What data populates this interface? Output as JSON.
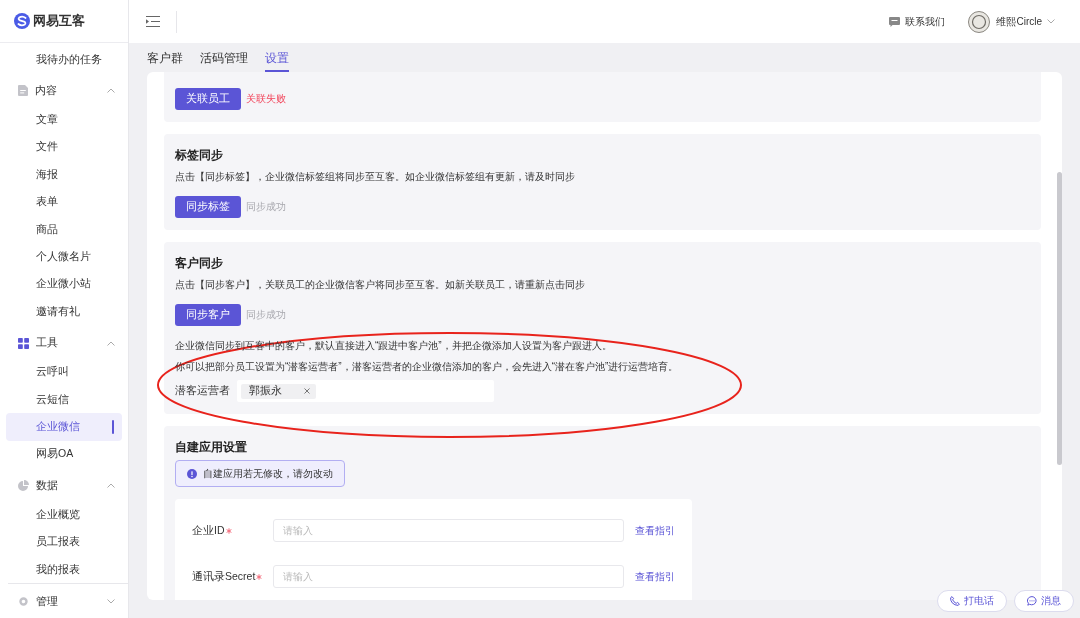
{
  "logo": {
    "text": "网易互客"
  },
  "header": {
    "contact": "联系我们",
    "user": "维熙Circle"
  },
  "sidebar": {
    "items": [
      {
        "kind": "link",
        "label": "我待办的任务",
        "selected": false
      },
      {
        "kind": "group",
        "label": "内容",
        "expanded": true,
        "active": false,
        "separated": false,
        "children": [
          {
            "label": "文章",
            "selected": false
          },
          {
            "label": "文件",
            "selected": false
          },
          {
            "label": "海报",
            "selected": false
          },
          {
            "label": "表单",
            "selected": false
          },
          {
            "label": "商品",
            "selected": false
          },
          {
            "label": "个人微名片",
            "selected": false
          },
          {
            "label": "企业微小站",
            "selected": false
          },
          {
            "label": "邀请有礼",
            "selected": false
          }
        ]
      },
      {
        "kind": "group",
        "label": "工具",
        "expanded": true,
        "active": true,
        "separated": false,
        "children": [
          {
            "label": "云呼叫",
            "selected": false
          },
          {
            "label": "云短信",
            "selected": false
          },
          {
            "label": "企业微信",
            "selected": true
          },
          {
            "label": "网易OA",
            "selected": false
          }
        ]
      },
      {
        "kind": "group",
        "label": "数据",
        "expanded": true,
        "active": false,
        "separated": false,
        "children": [
          {
            "label": "企业概览",
            "selected": false
          },
          {
            "label": "员工报表",
            "selected": false
          },
          {
            "label": "我的报表",
            "selected": false
          }
        ]
      },
      {
        "kind": "group",
        "label": "管理",
        "expanded": false,
        "active": false,
        "separated": true
      }
    ]
  },
  "tabs": [
    {
      "label": "客户群",
      "selected": false
    },
    {
      "label": "活码管理",
      "selected": false
    },
    {
      "label": "设置",
      "selected": true
    }
  ],
  "sections": [
    {
      "kind": "sync",
      "button": "关联员工",
      "status": {
        "text": "关联失败",
        "kind": "error"
      }
    },
    {
      "kind": "sync",
      "title": "标签同步",
      "description": "点击【同步标签】，企业微信标签组将同步至互客。如企业微信标签组有更新，请及时同步",
      "button": "同步标签",
      "status": {
        "text": "同步成功",
        "kind": "success"
      }
    },
    {
      "kind": "sync",
      "title": "客户同步",
      "description": "点击【同步客户】，关联员工的企业微信客户将同步至互客。如新关联员工，请重新点击同步",
      "button": "同步客户",
      "status": {
        "text": "同步成功",
        "kind": "success"
      },
      "notes": [
        "企业微信同步到互客中的客户，默认直接进入“跟进中客户池”，并把企微添加人设置为客户跟进人。",
        "你可以把部分员工设置为“潜客运营者”，潜客运营者的企业微信添加的客户，会先进入“潜在客户池”进行运营培育。"
      ],
      "operator_field": {
        "label": "潜客运营者",
        "tags": [
          "郭振永"
        ]
      }
    },
    {
      "kind": "app_settings",
      "title": "自建应用设置",
      "alert": "自建应用若无修改，请勿改动",
      "fields": [
        {
          "label": "企业ID",
          "required": true,
          "placeholder": "请输入",
          "link": "查看指引"
        },
        {
          "label": "通讯录Secret",
          "required": true,
          "placeholder": "请输入",
          "link": "查看指引"
        }
      ]
    }
  ],
  "floating_buttons": [
    {
      "kind": "call",
      "label": "打电话"
    },
    {
      "kind": "message",
      "label": "消息"
    }
  ]
}
